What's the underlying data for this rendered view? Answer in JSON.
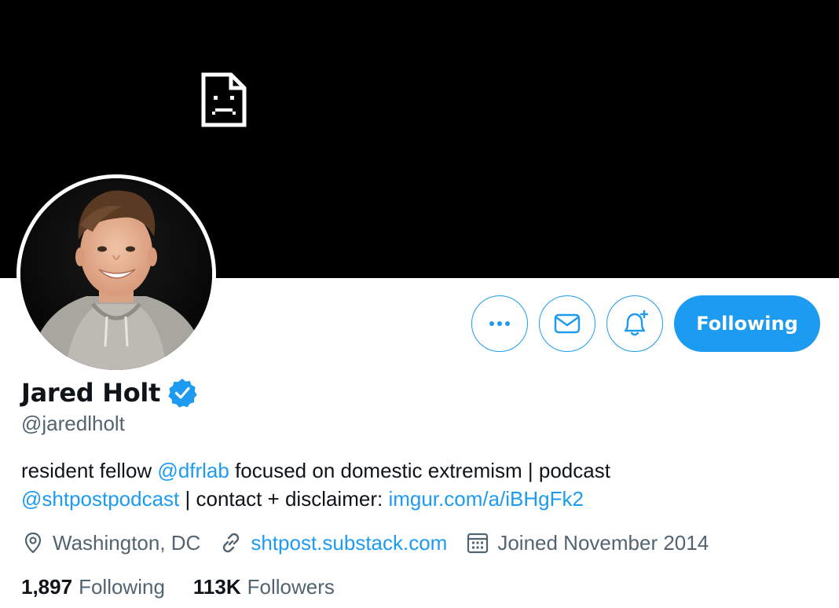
{
  "profile": {
    "display_name": "Jared Holt",
    "handle": "@jaredlholt",
    "verified": true,
    "bio": {
      "part1": "resident fellow ",
      "mention1": "@dfrlab",
      "part2": " focused on domestic extremism | podcast",
      "mention2": "@shtpostpodcast",
      "part3": " | contact + disclaimer: ",
      "link": "imgur.com/a/iBHgFk2"
    },
    "location": "Washington, DC",
    "website": "shtpost.substack.com",
    "joined": "Joined November 2014"
  },
  "actions": {
    "more_icon": "more-horizontal-icon",
    "message_icon": "envelope-icon",
    "notify_icon": "bell-plus-icon",
    "following_label": "Following"
  },
  "stats": {
    "following_count": "1,897",
    "following_label": "Following",
    "followers_count": "113K",
    "followers_label": "Followers"
  },
  "colors": {
    "accent": "#1d9bf0",
    "text_primary": "#0f1419",
    "text_secondary": "#536471",
    "banner": "#000000"
  }
}
